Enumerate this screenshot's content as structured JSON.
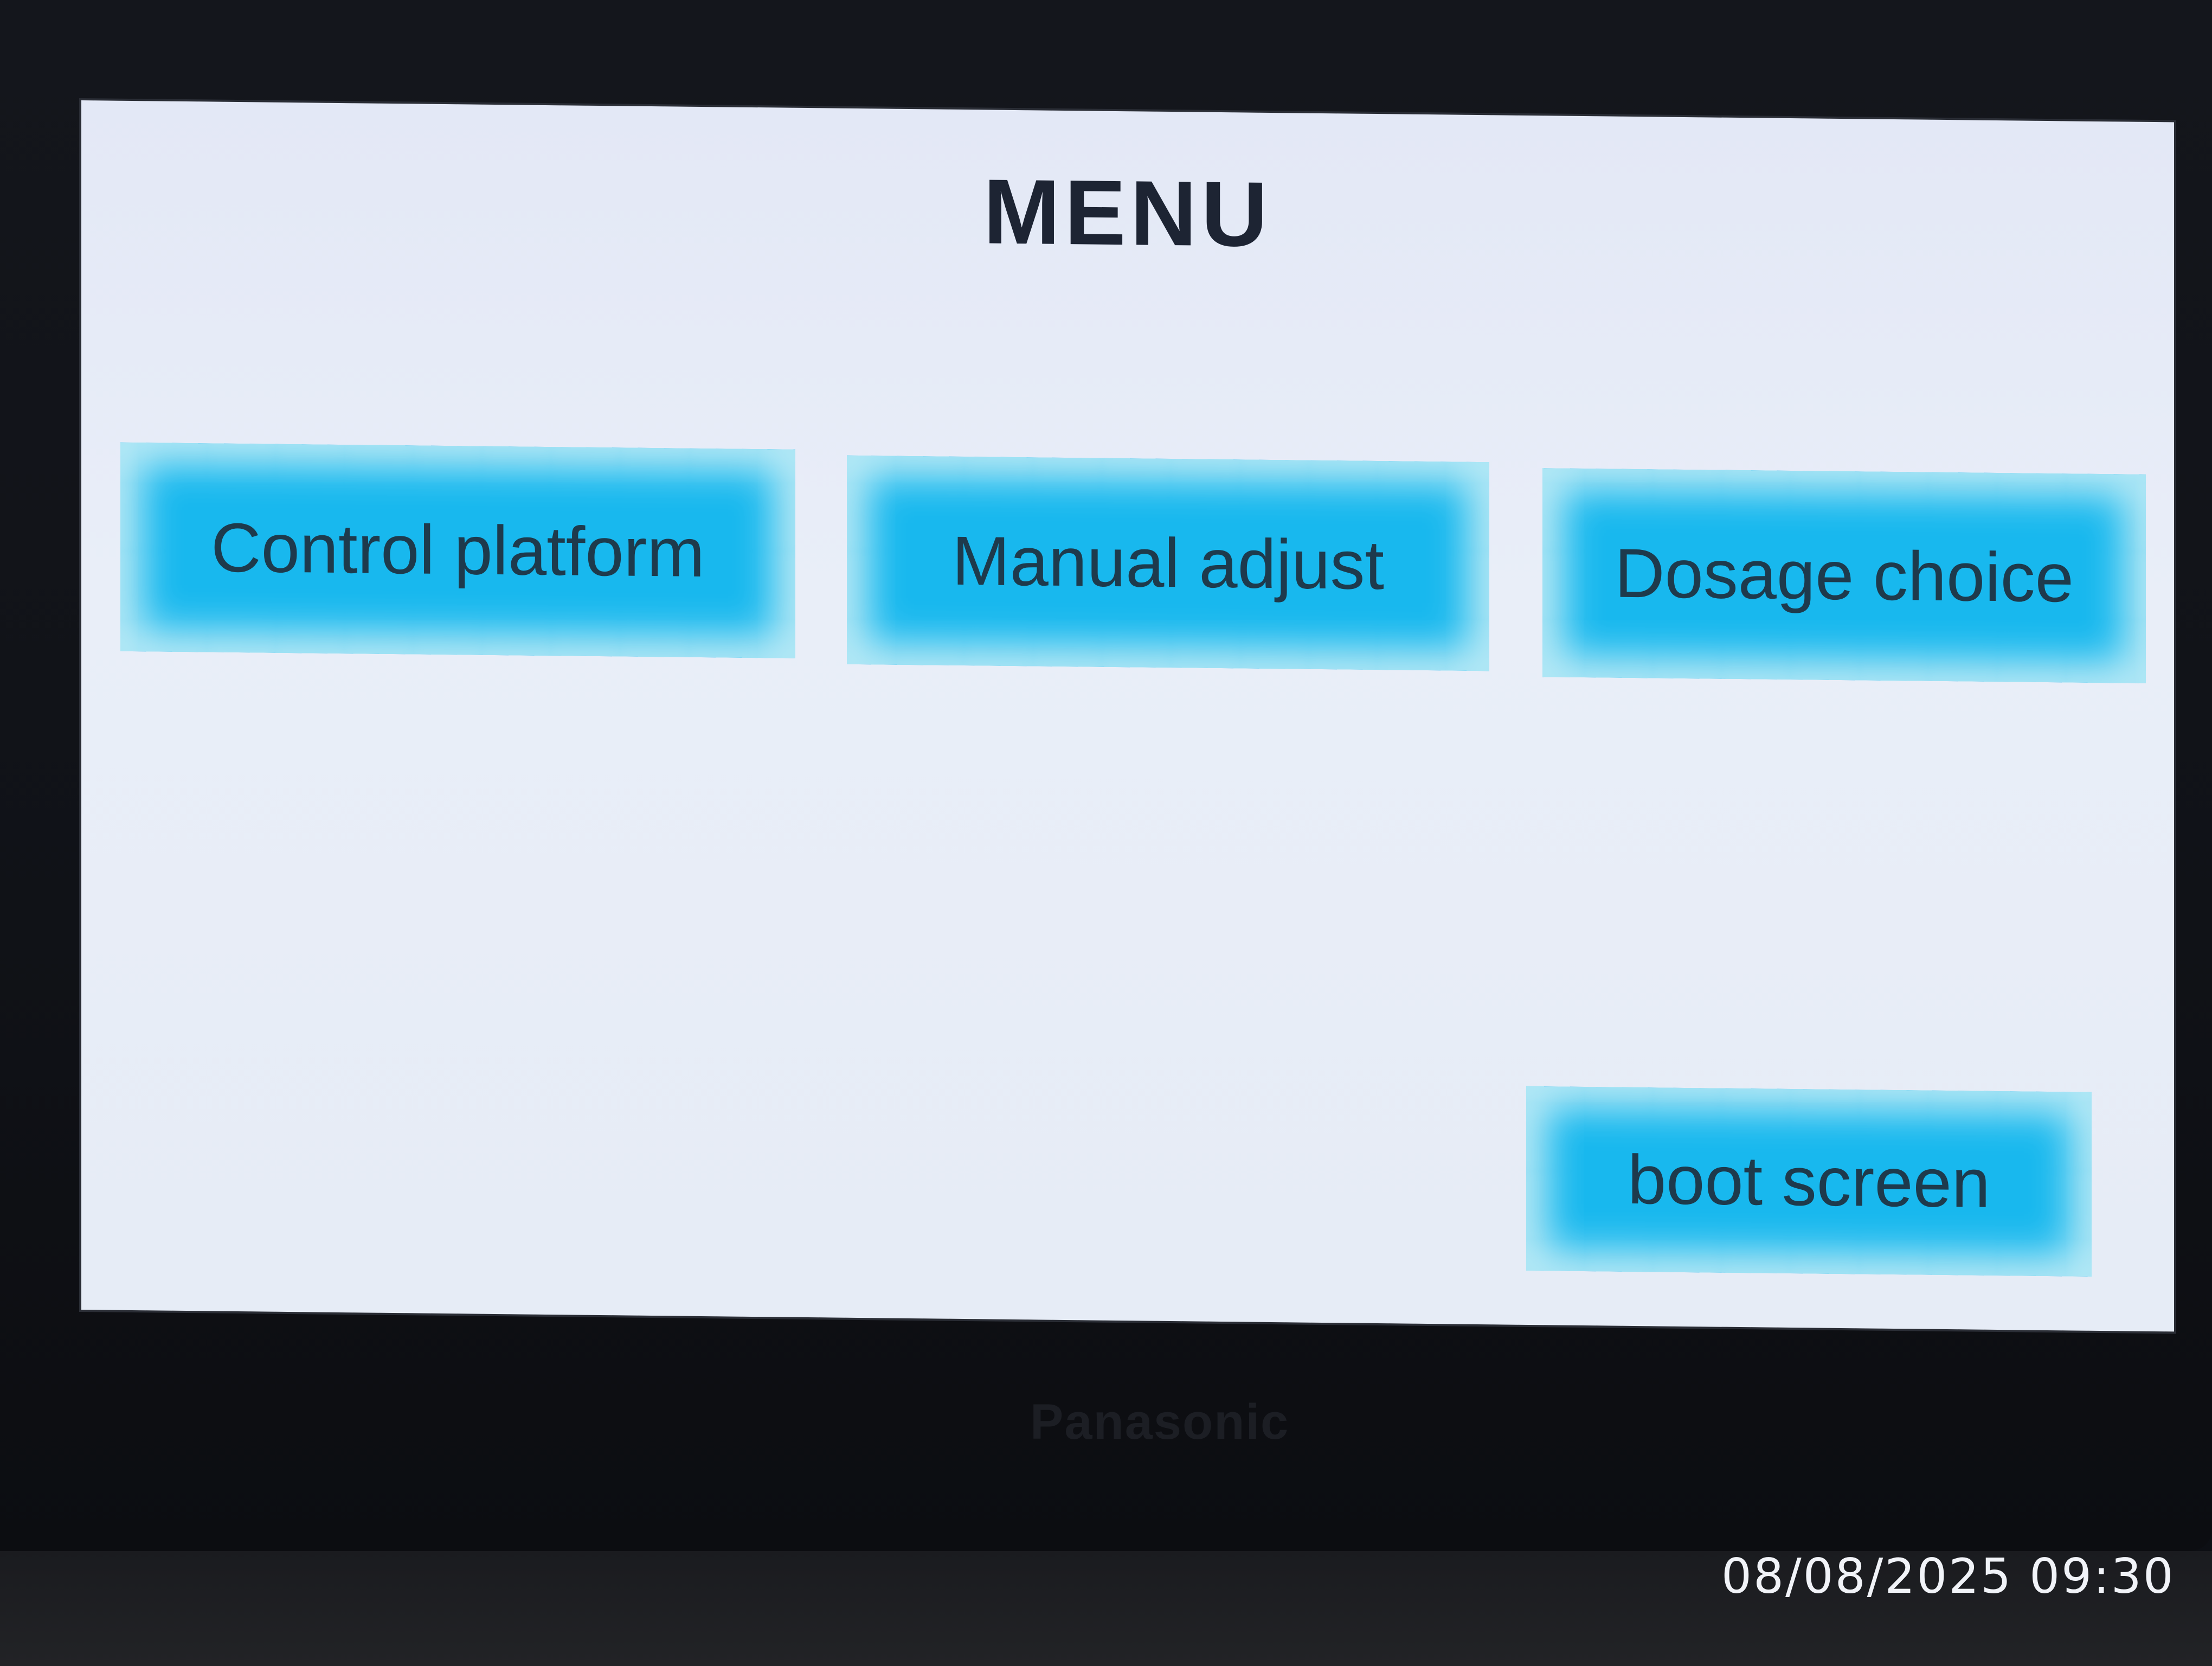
{
  "screen": {
    "title": "MENU",
    "buttons": [
      {
        "label": "Control platform"
      },
      {
        "label": "Manual adjust"
      },
      {
        "label": "Dosage choice"
      },
      {
        "label": "boot screen"
      }
    ]
  },
  "device": {
    "brand": "Panasonic"
  },
  "photo": {
    "timestamp": "08/08/2025 09:30"
  },
  "colors": {
    "button_accent": "#18b8ee",
    "screen_background": "#e6ecf6",
    "title_text": "#1d2433"
  }
}
